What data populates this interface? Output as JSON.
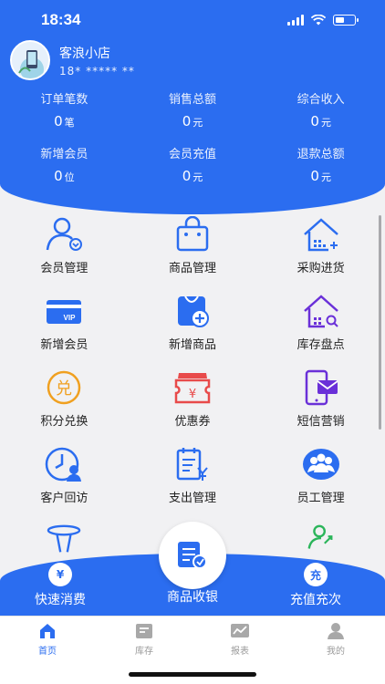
{
  "status_bar": {
    "time": "18:34"
  },
  "store": {
    "name": "客浪小店",
    "phone": "18* ***** **"
  },
  "stats": [
    [
      {
        "label": "订单笔数",
        "value": "0",
        "unit": "笔"
      },
      {
        "label": "销售总额",
        "value": "0",
        "unit": "元"
      },
      {
        "label": "综合收入",
        "value": "0",
        "unit": "元"
      }
    ],
    [
      {
        "label": "新增会员",
        "value": "0",
        "unit": "位"
      },
      {
        "label": "会员充值",
        "value": "0",
        "unit": "元"
      },
      {
        "label": "退款总额",
        "value": "0",
        "unit": "元"
      }
    ]
  ],
  "grid": [
    [
      {
        "label": "会员管理",
        "icon": "member-icon"
      },
      {
        "label": "商品管理",
        "icon": "bag-icon"
      },
      {
        "label": "采购进货",
        "icon": "warehouse-icon"
      }
    ],
    [
      {
        "label": "新增会员",
        "icon": "vip-card-icon"
      },
      {
        "label": "新增商品",
        "icon": "add-product-icon"
      },
      {
        "label": "库存盘点",
        "icon": "inventory-icon"
      }
    ],
    [
      {
        "label": "积分兑换",
        "icon": "points-icon"
      },
      {
        "label": "优惠券",
        "icon": "coupon-icon"
      },
      {
        "label": "短信营销",
        "icon": "sms-icon"
      }
    ],
    [
      {
        "label": "客户回访",
        "icon": "clock-user-icon"
      },
      {
        "label": "支出管理",
        "icon": "expense-icon"
      },
      {
        "label": "员工管理",
        "icon": "staff-icon"
      }
    ]
  ],
  "actions": {
    "quick_label": "快速消费",
    "quick_icon_text": "¥",
    "cashier_label": "商品收银",
    "recharge_label": "充值充次",
    "recharge_icon_text": "充"
  },
  "tabs": [
    {
      "label": "首页",
      "icon": "home-icon"
    },
    {
      "label": "库存",
      "icon": "inventory-tab-icon"
    },
    {
      "label": "报表",
      "icon": "report-icon"
    },
    {
      "label": "我的",
      "icon": "profile-icon"
    }
  ],
  "colors": {
    "primary": "#2b6df0",
    "accent_orange": "#f0a020",
    "accent_red": "#e84a4a",
    "accent_purple": "#6a30d8",
    "accent_green": "#2bb55a"
  }
}
